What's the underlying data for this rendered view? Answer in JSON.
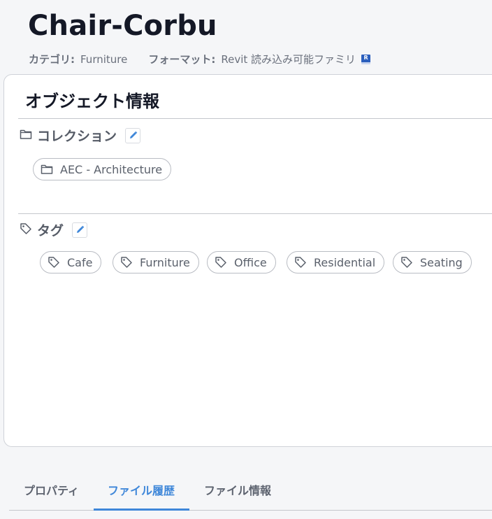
{
  "header": {
    "title": "Chair-Corbu",
    "category_label": "カテゴリ:",
    "category_value": "Furniture",
    "format_label": "フォーマット:",
    "format_value": "Revit 読み込み可能ファミリ",
    "format_icon": "revit-file-icon",
    "format_icon_text": "R"
  },
  "card": {
    "title": "オブジェクト情報",
    "collection": {
      "label": "コレクション",
      "icon": "folder-icon",
      "items": [
        "AEC - Architecture"
      ]
    },
    "tags": {
      "label": "タグ",
      "icon": "tag-icon",
      "items": [
        "Cafe",
        "Furniture",
        "Office",
        "Residential",
        "Seating"
      ]
    }
  },
  "tabs": {
    "items": [
      "プロパティ",
      "ファイル履歴",
      "ファイル情報"
    ],
    "active": "ファイル履歴"
  },
  "colors": {
    "accent": "#3f87d9",
    "title": "#141826",
    "muted": "#6a707c",
    "chip_border": "#b9bcc3",
    "background": "#f5f6f8"
  }
}
